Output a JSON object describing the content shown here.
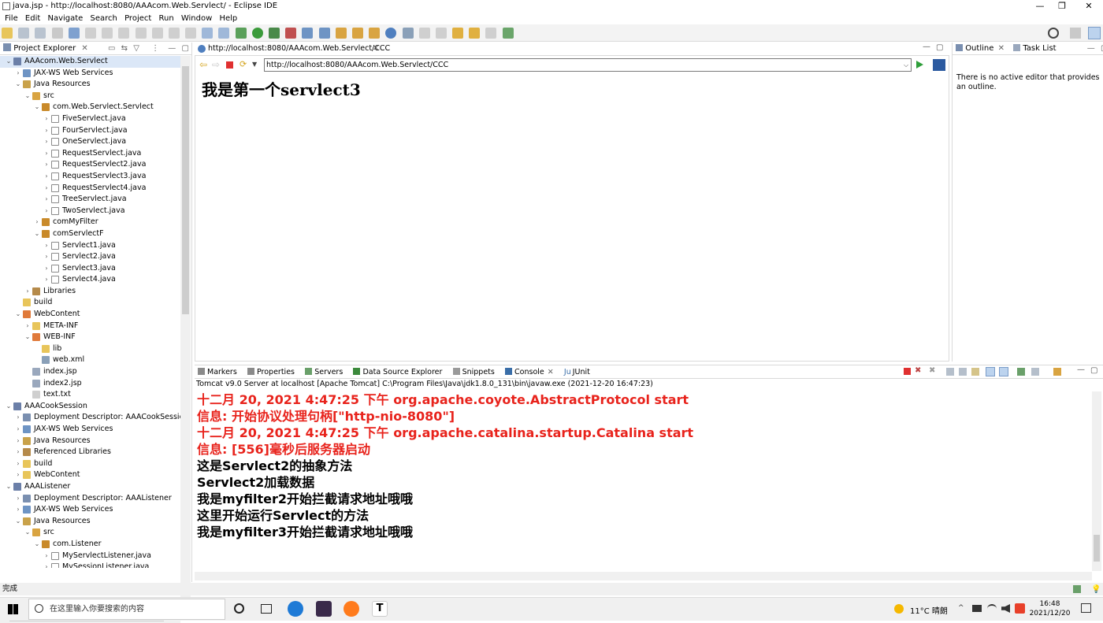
{
  "window": {
    "title": "java.jsp - http://localhost:8080/AAAcom.Web.Servlect/ - Eclipse IDE"
  },
  "menu": [
    "File",
    "Edit",
    "Navigate",
    "Search",
    "Project",
    "Run",
    "Window",
    "Help"
  ],
  "project_explorer": {
    "title": "Project Explorer",
    "items": [
      {
        "label": "AAAcom.Web.Servlect",
        "depth": 0,
        "arrow": "v",
        "icon": "project",
        "selected": true
      },
      {
        "label": "JAX-WS Web Services",
        "depth": 1,
        "arrow": ">",
        "icon": "ws"
      },
      {
        "label": "Java Resources",
        "depth": 1,
        "arrow": "v",
        "icon": "res"
      },
      {
        "label": "src",
        "depth": 2,
        "arrow": "v",
        "icon": "src"
      },
      {
        "label": "com.Web.Servlect.Servlect",
        "depth": 3,
        "arrow": "v",
        "icon": "pkg"
      },
      {
        "label": "FiveServlect.java",
        "depth": 4,
        "arrow": ">",
        "icon": "java"
      },
      {
        "label": "FourServlect.java",
        "depth": 4,
        "arrow": ">",
        "icon": "java"
      },
      {
        "label": "OneServlect.java",
        "depth": 4,
        "arrow": ">",
        "icon": "java"
      },
      {
        "label": "RequestServlect.java",
        "depth": 4,
        "arrow": ">",
        "icon": "java"
      },
      {
        "label": "RequestServlect2.java",
        "depth": 4,
        "arrow": ">",
        "icon": "java"
      },
      {
        "label": "RequestServlect3.java",
        "depth": 4,
        "arrow": ">",
        "icon": "java"
      },
      {
        "label": "RequestServlect4.java",
        "depth": 4,
        "arrow": ">",
        "icon": "java"
      },
      {
        "label": "TreeServlect.java",
        "depth": 4,
        "arrow": ">",
        "icon": "java"
      },
      {
        "label": "TwoServlect.java",
        "depth": 4,
        "arrow": ">",
        "icon": "java"
      },
      {
        "label": "comMyFilter",
        "depth": 3,
        "arrow": ">",
        "icon": "pkg"
      },
      {
        "label": "comServlectF",
        "depth": 3,
        "arrow": "v",
        "icon": "pkg"
      },
      {
        "label": "Servlect1.java",
        "depth": 4,
        "arrow": ">",
        "icon": "java"
      },
      {
        "label": "Servlect2.java",
        "depth": 4,
        "arrow": ">",
        "icon": "java"
      },
      {
        "label": "Servlect3.java",
        "depth": 4,
        "arrow": ">",
        "icon": "java"
      },
      {
        "label": "Servlect4.java",
        "depth": 4,
        "arrow": ">",
        "icon": "java"
      },
      {
        "label": "Libraries",
        "depth": 2,
        "arrow": ">",
        "icon": "lib"
      },
      {
        "label": "build",
        "depth": 1,
        "arrow": "",
        "icon": "folder"
      },
      {
        "label": "WebContent",
        "depth": 1,
        "arrow": "v",
        "icon": "webfolder"
      },
      {
        "label": "META-INF",
        "depth": 2,
        "arrow": ">",
        "icon": "folder"
      },
      {
        "label": "WEB-INF",
        "depth": 2,
        "arrow": "v",
        "icon": "webfolder"
      },
      {
        "label": "lib",
        "depth": 3,
        "arrow": "",
        "icon": "folder"
      },
      {
        "label": "web.xml",
        "depth": 3,
        "arrow": "",
        "icon": "xml"
      },
      {
        "label": "index.jsp",
        "depth": 2,
        "arrow": "",
        "icon": "jsp"
      },
      {
        "label": "index2.jsp",
        "depth": 2,
        "arrow": "",
        "icon": "jsp"
      },
      {
        "label": "text.txt",
        "depth": 2,
        "arrow": "",
        "icon": "txt"
      },
      {
        "label": "AAACookSession",
        "depth": 0,
        "arrow": "v",
        "icon": "project"
      },
      {
        "label": "Deployment Descriptor: AAACookSession",
        "depth": 1,
        "arrow": ">",
        "icon": "dd"
      },
      {
        "label": "JAX-WS Web Services",
        "depth": 1,
        "arrow": ">",
        "icon": "ws"
      },
      {
        "label": "Java Resources",
        "depth": 1,
        "arrow": ">",
        "icon": "res"
      },
      {
        "label": "Referenced Libraries",
        "depth": 1,
        "arrow": ">",
        "icon": "lib"
      },
      {
        "label": "build",
        "depth": 1,
        "arrow": ">",
        "icon": "folder"
      },
      {
        "label": "WebContent",
        "depth": 1,
        "arrow": ">",
        "icon": "folder"
      },
      {
        "label": "AAAListener",
        "depth": 0,
        "arrow": "v",
        "icon": "project"
      },
      {
        "label": "Deployment Descriptor: AAAListener",
        "depth": 1,
        "arrow": ">",
        "icon": "dd"
      },
      {
        "label": "JAX-WS Web Services",
        "depth": 1,
        "arrow": ">",
        "icon": "ws"
      },
      {
        "label": "Java Resources",
        "depth": 1,
        "arrow": "v",
        "icon": "res"
      },
      {
        "label": "src",
        "depth": 2,
        "arrow": "v",
        "icon": "src"
      },
      {
        "label": "com.Listener",
        "depth": 3,
        "arrow": "v",
        "icon": "pkg"
      },
      {
        "label": "MyServlectListener.java",
        "depth": 4,
        "arrow": ">",
        "icon": "java"
      },
      {
        "label": "MySessionListener.java",
        "depth": 4,
        "arrow": ">",
        "icon": "java"
      }
    ]
  },
  "browser": {
    "tab": "http://localhost:8080/AAAcom.Web.Servlect/CCC",
    "url": "http://localhost:8080/AAAcom.Web.Servlect/CCC",
    "content": "我是第一个servlect3"
  },
  "outline": {
    "tab1": "Outline",
    "tab2": "Task List",
    "message": "There is no active editor that provides an outline."
  },
  "console": {
    "tabs": [
      "Markers",
      "Properties",
      "Servers",
      "Data Source Explorer",
      "Snippets",
      "Console",
      "JUnit"
    ],
    "header": "Tomcat v9.0 Server at localhost [Apache Tomcat] C:\\Program Files\\Java\\jdk1.8.0_131\\bin\\javaw.exe  (2021-12-20 16:47:23)",
    "lines": [
      {
        "text": "十二月 20, 2021 4:47:25 下午 org.apache.coyote.AbstractProtocol start",
        "color": "red"
      },
      {
        "text": "信息: 开始协议处理句柄[\"http-nio-8080\"]",
        "color": "red"
      },
      {
        "text": "十二月 20, 2021 4:47:25 下午 org.apache.catalina.startup.Catalina start",
        "color": "red"
      },
      {
        "text": "信息: [556]毫秒后服务器启动",
        "color": "red"
      },
      {
        "text": "这是Servlect2的抽象方法",
        "color": "black"
      },
      {
        "text": "Servlect2加载数据",
        "color": "black"
      },
      {
        "text": "我是myfilter2开始拦截请求地址哦哦",
        "color": "black"
      },
      {
        "text": "这里开始运行Servlect的方法",
        "color": "black"
      },
      {
        "text": "我是myfilter3开始拦截请求地址哦哦",
        "color": "black"
      }
    ]
  },
  "status": {
    "text": "完成"
  },
  "taskbar": {
    "search_placeholder": "在这里输入你要搜索的内容",
    "weather": "11°C 晴朗",
    "time": "16:48",
    "date": "2021/12/20"
  },
  "colors": {
    "red": "#e8231c",
    "selection": "#dbe7f7"
  }
}
